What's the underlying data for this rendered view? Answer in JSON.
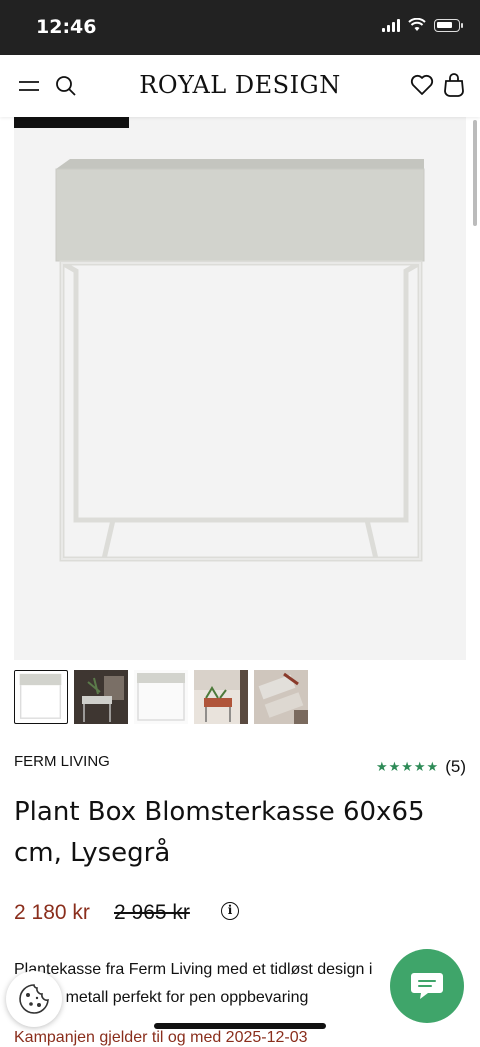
{
  "status_bar": {
    "time": "12:46"
  },
  "header": {
    "logo": "ROYAL DESIGN"
  },
  "product": {
    "brand": "FERM LIVING",
    "rating_stars": "★★★★★",
    "rating_count": "(5)",
    "title": "Plant Box Blomsterkasse 60x65 cm, Lysegrå",
    "price": "2 180 kr",
    "old_price": "2 965 kr",
    "description": "Plantekasse fra Ferm Living med et tidløst design i lakkert metall perfekt for pen oppbevaring",
    "campaign": "Kampanjen gjelder til og med 2025-12-03"
  },
  "colors": {
    "price": "#8a2e1c",
    "stars": "#2e8b57",
    "chat": "#3fa56a"
  }
}
